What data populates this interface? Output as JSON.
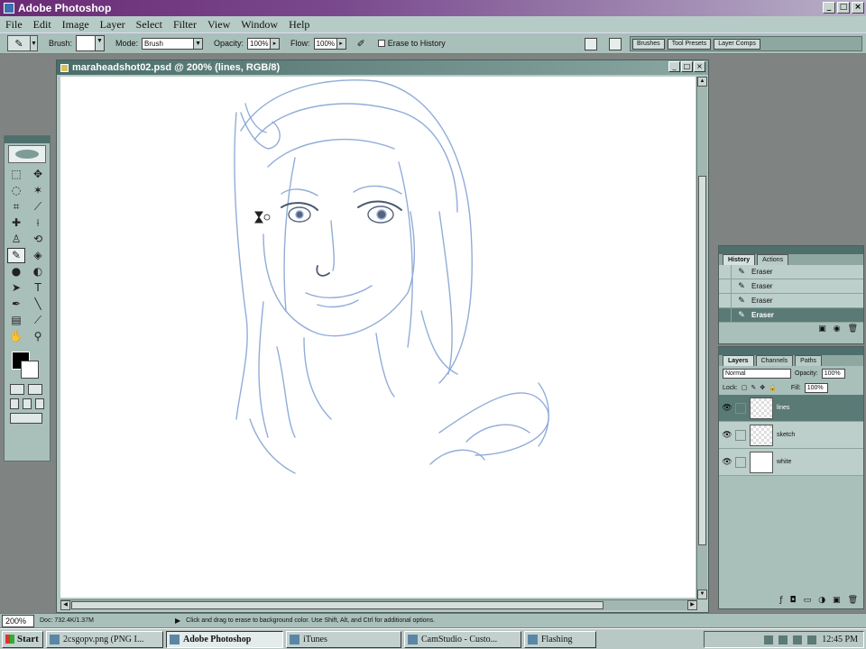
{
  "app": {
    "title": "Adobe Photoshop"
  },
  "menu": [
    "File",
    "Edit",
    "Image",
    "Layer",
    "Select",
    "Filter",
    "View",
    "Window",
    "Help"
  ],
  "options": {
    "brush_label": "Brush:",
    "mode_label": "Mode:",
    "mode_value": "Brush",
    "opacity_label": "Opacity:",
    "opacity_value": "100%",
    "flow_label": "Flow:",
    "flow_value": "100%",
    "erase_history_label": "Erase to History",
    "well_tabs": [
      "Brushes",
      "Tool Presets",
      "Layer Comps"
    ]
  },
  "document": {
    "title": "maraheadshot02.psd @ 200% (lines, RGB/8)"
  },
  "history": {
    "tabs": [
      "History",
      "Actions"
    ],
    "items": [
      "Eraser",
      "Eraser",
      "Eraser",
      "Eraser"
    ],
    "selected_index": 3
  },
  "layers": {
    "tabs": [
      "Layers",
      "Channels",
      "Paths"
    ],
    "blend_mode": "Normal",
    "opacity_label": "Opacity:",
    "opacity_value": "100%",
    "lock_label": "Lock:",
    "fill_label": "Fill:",
    "fill_value": "100%",
    "items": [
      {
        "name": "lines",
        "selected": true
      },
      {
        "name": "sketch",
        "selected": false
      },
      {
        "name": "white",
        "selected": false
      }
    ]
  },
  "status": {
    "zoom": "200%",
    "doc_info": "Doc: 732.4K/1.37M",
    "hint": "Click and drag to erase to background color.  Use Shift, Alt, and Ctrl for additional options."
  },
  "taskbar": {
    "start": "Start",
    "tasks": [
      {
        "label": "2csgopv.png (PNG I...",
        "active": false
      },
      {
        "label": "Adobe Photoshop",
        "active": true
      },
      {
        "label": "iTunes",
        "active": false
      },
      {
        "label": "CamStudio - Custo...",
        "active": false
      },
      {
        "label": "Flashing",
        "active": false
      }
    ],
    "clock": "12:45 PM"
  },
  "colors": {
    "sketch_stroke": "#7f9ed2",
    "selection": "#5a7a76",
    "title_bar": "#6a2b74"
  }
}
